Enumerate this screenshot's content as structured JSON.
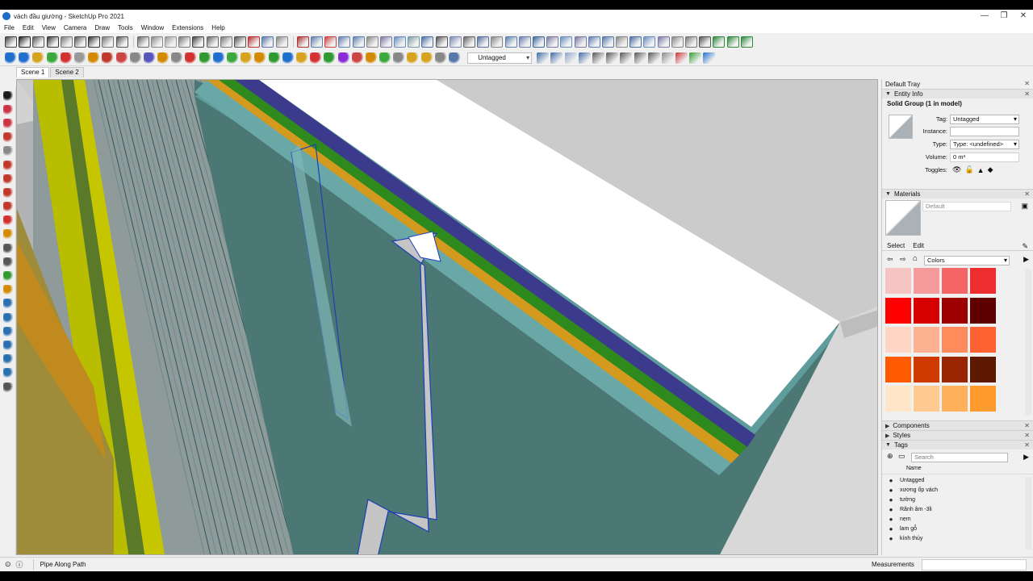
{
  "window": {
    "title": "vách đầu giường - SketchUp Pro 2021",
    "controls": [
      "—",
      "❐",
      "✕"
    ]
  },
  "menu": [
    "File",
    "Edit",
    "View",
    "Camera",
    "Draw",
    "Tools",
    "Window",
    "Extensions",
    "Help"
  ],
  "toolbar2": {
    "tag_value": "Untagged"
  },
  "scenes": [
    {
      "label": "Scene 1",
      "active": true
    },
    {
      "label": "Scene 2",
      "active": false
    }
  ],
  "tray": {
    "title": "Default Tray",
    "entity_info": {
      "header": "Entity Info",
      "selection": "Solid Group (1 in model)",
      "tag_label": "Tag:",
      "tag_value": "Untagged",
      "instance_label": "Instance:",
      "instance_value": "",
      "type_label": "Type:",
      "type_value": "Type: <undefined>",
      "volume_label": "Volume:",
      "volume_value": "0 m³",
      "toggles_label": "Toggles:"
    },
    "materials": {
      "header": "Materials",
      "current": "Default",
      "tabs": [
        "Select",
        "Edit"
      ],
      "library": "Colors",
      "swatches": [
        "#f7c4c4",
        "#f59a9a",
        "#f56565",
        "#ee2e2e",
        "#ff0000",
        "#d50000",
        "#9c0000",
        "#5e0000",
        "#ffd6c6",
        "#ffb291",
        "#ff8a5c",
        "#ff6232",
        "#ff5a00",
        "#cf3a00",
        "#992600",
        "#5c1800",
        "#ffe6c9",
        "#ffc990",
        "#ffb05b",
        "#ff9b2e"
      ]
    },
    "components_header": "Components",
    "styles_header": "Styles",
    "tags": {
      "header": "Tags",
      "search_placeholder": "Search",
      "column_name": "Name",
      "items": [
        "Untagged",
        "xương ốp vách",
        "tường",
        "Rãnh âm -3li",
        "nẹm",
        "lam gỗ",
        "kính thủy"
      ]
    }
  },
  "status": {
    "hint": "Pipe Along Path",
    "measurements_label": "Measurements"
  }
}
